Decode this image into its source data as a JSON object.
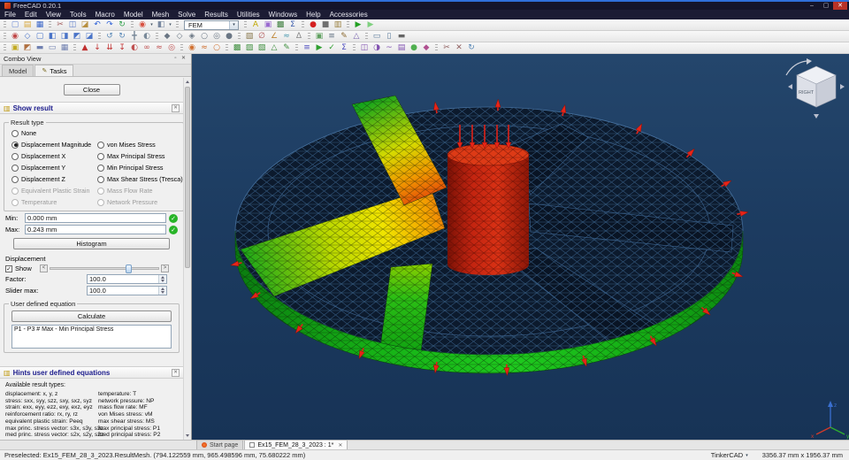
{
  "icons": {
    "check": "✓",
    "close": "✕",
    "caret_down": "▾",
    "pencil": "✎",
    "float": "▫",
    "left_arrow": "<",
    "right_arrow": ">"
  },
  "titlebar": {
    "title": "FreeCAD 0.20.1",
    "minimize": "–",
    "maximize": "▢",
    "close": "✕"
  },
  "menubar": {
    "items": [
      "File",
      "Edit",
      "View",
      "Tools",
      "Macro",
      "Model",
      "Mesh",
      "Solve",
      "Results",
      "Utilities",
      "Windows",
      "Help",
      "Accessories"
    ]
  },
  "toolbars": {
    "row1": [
      [
        {
          "n": "file-new-icon",
          "g": "▢",
          "c": "#6e8cd8"
        },
        {
          "n": "file-open-icon",
          "g": "▤",
          "c": "#d8a73a"
        },
        {
          "n": "file-save-icon",
          "g": "▦",
          "c": "#3a66c8"
        }
      ],
      [
        {
          "n": "cut-icon",
          "g": "✂",
          "c": "#a05858"
        },
        {
          "n": "copy-icon",
          "g": "◫",
          "c": "#5878c8"
        },
        {
          "n": "paste-icon",
          "g": "◪",
          "c": "#b89040"
        },
        {
          "n": "undo-icon",
          "g": "↶",
          "c": "#2f62d8"
        },
        {
          "n": "redo-icon",
          "g": "↷",
          "c": "#2f62d8"
        },
        {
          "n": "refresh-icon",
          "g": "↻",
          "c": "#2fa04a"
        }
      ],
      [
        {
          "n": "zoom-fit-icon",
          "g": "◉",
          "c": "#d85040"
        },
        {
          "caret": true
        },
        {
          "n": "view-cube-icon",
          "g": "◧",
          "c": "#7888a0"
        },
        {
          "caret": true
        }
      ],
      [
        {
          "combo": true,
          "n": "workbench-selector",
          "value": "FEM"
        }
      ],
      [
        {
          "n": "fem-analysis-icon",
          "g": "A",
          "c": "#c0a800"
        },
        {
          "n": "fem-constraint-icon",
          "g": "▣",
          "c": "#9a6ad0"
        },
        {
          "n": "fem-mesh-icon",
          "g": "▩",
          "c": "#3f7f3f"
        },
        {
          "n": "fem-equation-icon",
          "g": "Σ",
          "c": "#3f5fae"
        }
      ],
      [
        {
          "n": "macro-record-icon",
          "g": "●",
          "c": "#d42020"
        },
        {
          "n": "macro-stop-icon",
          "g": "■",
          "c": "#707070"
        },
        {
          "n": "macro-open-icon",
          "g": "▥",
          "c": "#9a8040"
        }
      ],
      [
        {
          "n": "macro-play-icon",
          "g": "▶",
          "c": "#22a022"
        },
        {
          "n": "macro-debug-icon",
          "g": "▶",
          "c": "#7fd07f"
        }
      ]
    ],
    "row2": [
      [
        {
          "n": "view-fit-icon",
          "g": "◉",
          "c": "#c04848"
        },
        {
          "n": "view-axonometric-icon",
          "g": "◇",
          "c": "#4a74c8"
        },
        {
          "n": "view-front-icon",
          "g": "▢",
          "c": "#4a74c8"
        },
        {
          "n": "view-top-icon",
          "g": "◧",
          "c": "#4a74c8"
        },
        {
          "n": "view-right-icon",
          "g": "◨",
          "c": "#4a74c8"
        },
        {
          "n": "view-rear-icon",
          "g": "◩",
          "c": "#4a74c8"
        },
        {
          "n": "view-bottom-icon",
          "g": "◪",
          "c": "#4a74c8"
        }
      ],
      [
        {
          "n": "rotate-left-icon",
          "g": "↺",
          "c": "#5585b5"
        },
        {
          "n": "rotate-right-icon",
          "g": "↻",
          "c": "#5585b5"
        },
        {
          "n": "pan-icon",
          "g": "╋",
          "c": "#7a8a9a"
        },
        {
          "n": "orbit-icon",
          "g": "◐",
          "c": "#7a8a9a"
        }
      ],
      [
        {
          "n": "drawstyle-asis-icon",
          "g": "◆",
          "c": "#6a7684"
        },
        {
          "n": "drawstyle-wireframe-icon",
          "g": "◇",
          "c": "#6a7684"
        },
        {
          "n": "drawstyle-shaded-icon",
          "g": "◈",
          "c": "#6a7684"
        },
        {
          "n": "drawstyle-points-icon",
          "g": "○",
          "c": "#6a7684"
        },
        {
          "n": "drawstyle-hidden-icon",
          "g": "◎",
          "c": "#6a7684"
        },
        {
          "n": "drawstyle-flat-icon",
          "g": "●",
          "c": "#6a7684"
        }
      ],
      [
        {
          "n": "texture-icon",
          "g": "▧",
          "c": "#8a7a50"
        },
        {
          "n": "clipping-icon",
          "g": "∅",
          "c": "#b05858"
        },
        {
          "n": "measure-angle-icon",
          "g": "∠",
          "c": "#c08838"
        },
        {
          "n": "measure-wave-icon",
          "g": "≈",
          "c": "#4a9ab0"
        },
        {
          "n": "measure-delta-icon",
          "g": "Δ",
          "c": "#888888"
        }
      ],
      [
        {
          "n": "selection-view-icon",
          "g": "▣",
          "c": "#60a060"
        },
        {
          "n": "tree-view-icon",
          "g": "≡",
          "c": "#607080"
        },
        {
          "n": "edit-mode-icon",
          "g": "✎",
          "c": "#8a6a30"
        },
        {
          "n": "triad-icon",
          "g": "△",
          "c": "#7a66b0"
        }
      ],
      [
        {
          "n": "box-select-icon",
          "g": "▭",
          "c": "#5a7a9a"
        },
        {
          "n": "box-zoom-icon",
          "g": "▯",
          "c": "#5a7a9a"
        },
        {
          "n": "dock-views-icon",
          "g": "▬",
          "c": "#666666"
        }
      ]
    ],
    "row3": [
      [
        {
          "n": "analysis-container-icon",
          "g": "▣",
          "c": "#c2aa22"
        },
        {
          "n": "material-solid-icon",
          "g": "◩",
          "c": "#b07040"
        },
        {
          "n": "element-beam-icon",
          "g": "▬",
          "c": "#7080b0"
        },
        {
          "n": "element-shell-icon",
          "g": "▭",
          "c": "#7080b0"
        },
        {
          "n": "element-solid-icon",
          "g": "▦",
          "c": "#7080b0"
        }
      ],
      [
        {
          "n": "constraint-fixed-icon",
          "g": "▲",
          "c": "#c03030"
        },
        {
          "n": "constraint-force-icon",
          "g": "↓",
          "c": "#c03030"
        },
        {
          "n": "constraint-pressure-icon",
          "g": "⇊",
          "c": "#c03030"
        },
        {
          "n": "constraint-displacement-icon",
          "g": "↧",
          "c": "#c03030"
        },
        {
          "n": "constraint-contact-icon",
          "g": "◐",
          "c": "#c05050"
        },
        {
          "n": "constraint-tie-icon",
          "g": "∞",
          "c": "#c05050"
        },
        {
          "n": "constraint-spring-icon",
          "g": "≈",
          "c": "#c05050"
        },
        {
          "n": "constraint-bearing-icon",
          "g": "◎",
          "c": "#c05050"
        }
      ],
      [
        {
          "n": "constraint-temperature-icon",
          "g": "◉",
          "c": "#d07030"
        },
        {
          "n": "constraint-heatflux-icon",
          "g": "≈",
          "c": "#d07030"
        },
        {
          "n": "constraint-initialtemp-icon",
          "g": "○",
          "c": "#d07030"
        }
      ],
      [
        {
          "n": "mesh-netgen-icon",
          "g": "▩",
          "c": "#3f8f3f"
        },
        {
          "n": "mesh-gmsh-icon",
          "g": "▨",
          "c": "#3f8f3f"
        },
        {
          "n": "mesh-region-icon",
          "g": "▧",
          "c": "#3f8f3f"
        },
        {
          "n": "mesh-group-icon",
          "g": "△",
          "c": "#3f8f3f"
        },
        {
          "n": "mesh-edit-icon",
          "g": "✎",
          "c": "#3f8f3f"
        }
      ],
      [
        {
          "n": "solver-ccx-icon",
          "g": "≡",
          "c": "#5050c0"
        },
        {
          "n": "solver-run-icon",
          "g": "▶",
          "c": "#30a030"
        },
        {
          "n": "solver-check-icon",
          "g": "✓",
          "c": "#30a030"
        },
        {
          "n": "solver-equation-icon",
          "g": "Σ",
          "c": "#5050c0"
        }
      ],
      [
        {
          "n": "result-show-icon",
          "g": "◫",
          "c": "#8050b0"
        },
        {
          "n": "result-pipeline-icon",
          "g": "◑",
          "c": "#8050b0"
        },
        {
          "n": "result-graph-icon",
          "g": "~",
          "c": "#8050b0"
        },
        {
          "n": "result-table-icon",
          "g": "▤",
          "c": "#8050b0"
        },
        {
          "n": "result-point-icon",
          "g": "●",
          "c": "#50b050"
        },
        {
          "n": "result-clip-icon",
          "g": "◆",
          "c": "#b05090"
        }
      ],
      [
        {
          "n": "mesh-cut-icon",
          "g": "✂",
          "c": "#906060"
        },
        {
          "n": "purge-results-icon",
          "g": "✕",
          "c": "#906060"
        },
        {
          "n": "reload-icon",
          "g": "↻",
          "c": "#5585b5"
        }
      ]
    ]
  },
  "combo_view": {
    "title": "Combo View",
    "tabs": [
      "Model",
      "Tasks"
    ],
    "close_button": "Close",
    "show_result": {
      "title": "Show result",
      "icon_glyph": "▥",
      "result_type_label": "Result type",
      "options_left": [
        {
          "label": "None"
        },
        {
          "label": "Displacement Magnitude",
          "checked": true
        },
        {
          "label": "Displacement X"
        },
        {
          "label": "Displacement Y"
        },
        {
          "label": "Displacement Z"
        },
        {
          "label": "Equivalent Plastic Strain",
          "disabled": true
        },
        {
          "label": "Temperature",
          "disabled": true
        }
      ],
      "options_right": [
        {
          "spacer": true
        },
        {
          "label": "von Mises Stress"
        },
        {
          "label": "Max Principal Stress"
        },
        {
          "label": "Min Principal Stress"
        },
        {
          "label": "Max Shear Stress (Tresca)"
        },
        {
          "label": "Mass Flow Rate",
          "disabled": true
        },
        {
          "label": "Network Pressure",
          "disabled": true
        }
      ],
      "min_label": "Min:",
      "min_value": "0.000 mm",
      "max_label": "Max:",
      "max_value": "0.243 mm",
      "histogram_button": "Histogram",
      "displacement_label": "Displacement",
      "show_label": "Show",
      "factor_label": "Factor:",
      "factor_value": "100.0",
      "slider_max_label": "Slider max:",
      "slider_max_value": "100.0",
      "equation_group_label": "User defined equation",
      "calculate_button": "Calculate",
      "equation_text": "P1 - P3 # Max - Min Principal Stress"
    },
    "hints": {
      "title": "Hints user defined equations",
      "icon_glyph": "▥",
      "subtitle": "Available result types:",
      "left": [
        "displacement: x, y, z",
        "stress: sxx, syy, szz, sxy, sxz, syz",
        "strain: exx, eyy, ezz, exy, exz, eyz",
        "reinforcement ratio: rx, ry, rz",
        "equivalent plastic strain: Peeq",
        "max princ. stress vector: s3x, s3y, s3z",
        "med princ. stress vector: s2x, s2y, s2z"
      ],
      "right": [
        "temperature: T",
        "network pressure: NP",
        "mass flow rate: MF",
        "von Mises stress: vM",
        "max shear stress: MS",
        "max principal stress: P1",
        "med principal stress: P2"
      ]
    }
  },
  "viewport": {
    "nav_cube_face": "RIGHT",
    "axis_x": "x",
    "axis_y": "y",
    "axis_z": "z"
  },
  "document_tabs": [
    {
      "label": "Start page",
      "active": false
    },
    {
      "label": "Ex15_FEM_28_3_2023 : 1*",
      "active": true,
      "closable": true
    }
  ],
  "statusbar": {
    "message": "Preselected: Ex15_FEM_28_3_2023.ResultMesh. (794.122559 mm, 965.498596 mm, 75.680222 mm)",
    "nav_style": "TinkerCAD",
    "view_size": "3356.37 mm x 1956.37 mm"
  }
}
